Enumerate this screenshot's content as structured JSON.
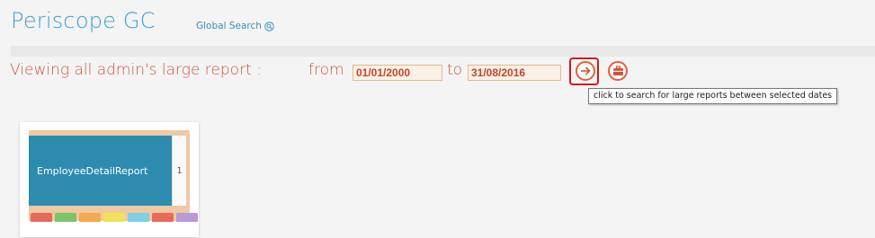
{
  "header": {
    "app_title": "Periscope GC",
    "global_search_label": "Global Search"
  },
  "filter": {
    "heading": "Viewing all admin's large report :",
    "from_label": "from",
    "from_date": "01/01/2000",
    "to_label": "to",
    "to_date": "31/08/2016",
    "search_tooltip": "click to search for large reports between selected dates"
  },
  "reports": [
    {
      "title": "EmployeeDetailReport",
      "count": "1",
      "tab_colors": [
        "#e86a5a",
        "#7bc46a",
        "#f3a94e",
        "#f5e05a",
        "#7fd0e6",
        "#e86a5a",
        "#b79ad6"
      ]
    }
  ],
  "colors": {
    "title_blue": "#3b9cd0",
    "heading_orange": "#d0553a",
    "highlight_red": "#d11a1a",
    "binder_blue": "#2e8bb0"
  },
  "icons": {
    "global_search": "magnifier-icon",
    "go": "arrow-right-circle-icon",
    "reset": "briefcase-icon"
  }
}
